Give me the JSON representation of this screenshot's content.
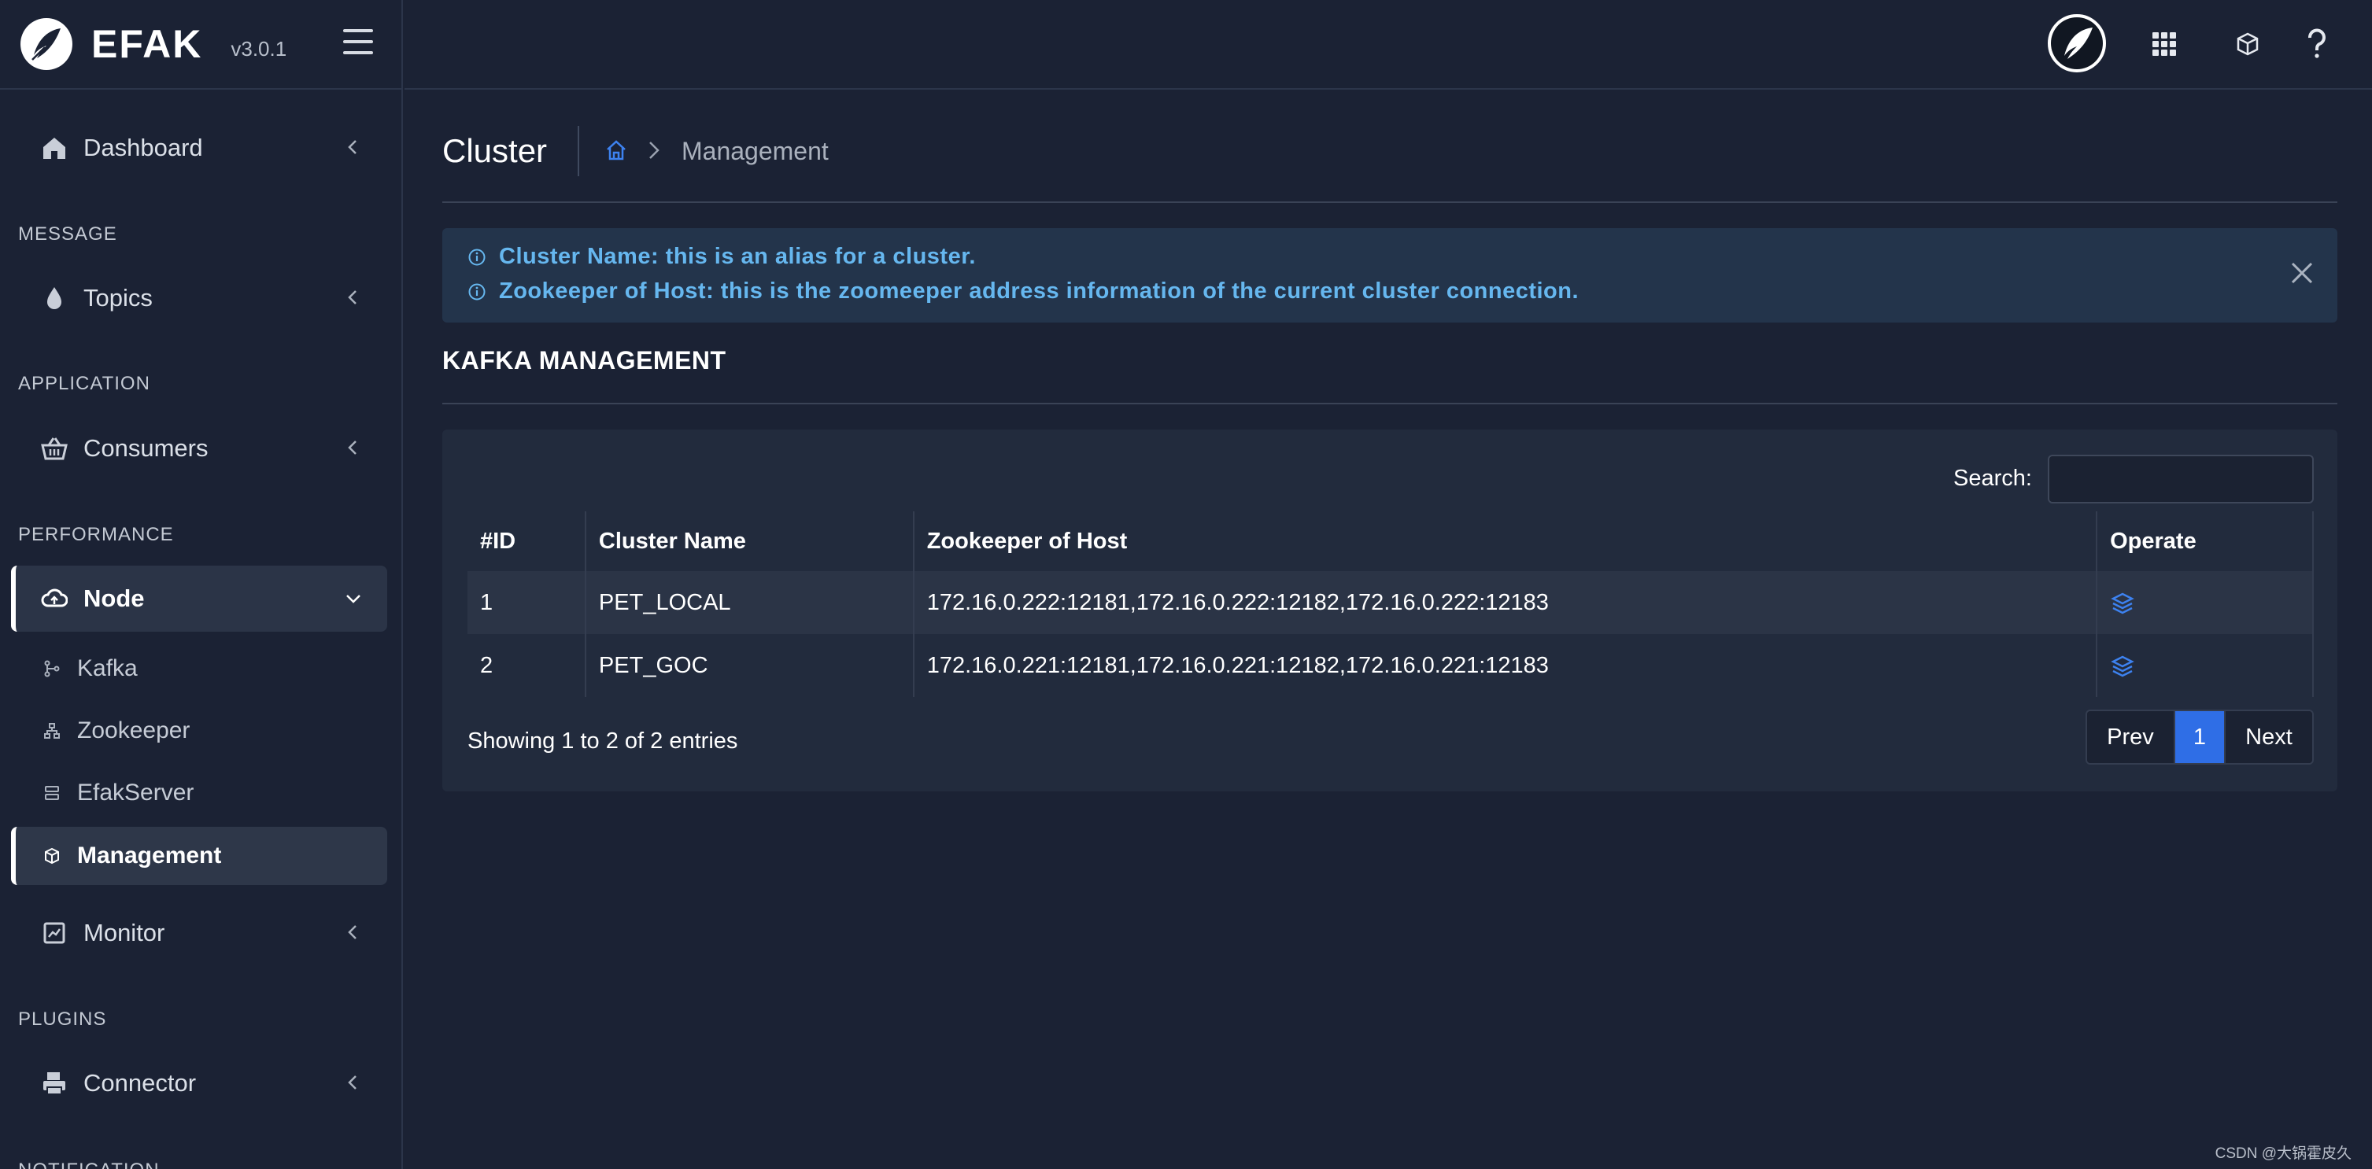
{
  "app": {
    "name": "EFAK",
    "version": "v3.0.1"
  },
  "sidebar": {
    "dashboard": "Dashboard",
    "sections": {
      "message": "MESSAGE",
      "application": "APPLICATION",
      "performance": "PERFORMANCE",
      "plugins": "PLUGINS",
      "notification": "NOTIFICATION"
    },
    "topics": "Topics",
    "consumers": "Consumers",
    "node": "Node",
    "node_children": [
      "Kafka",
      "Zookeeper",
      "EfakServer",
      "Management"
    ],
    "monitor": "Monitor",
    "connector": "Connector"
  },
  "page": {
    "title": "Cluster",
    "breadcrumb_current": "Management"
  },
  "alert": {
    "lines": [
      "Cluster Name: this is an alias for a cluster.",
      "Zookeeper of Host: this is the zoomeeper address information of the current cluster connection."
    ]
  },
  "section_title": "KAFKA MANAGEMENT",
  "table": {
    "search_label": "Search:",
    "search_value": "",
    "columns": [
      "#ID",
      "Cluster Name",
      "Zookeeper of Host",
      "Operate"
    ],
    "rows": [
      {
        "id": "1",
        "name": "PET_LOCAL",
        "host": "172.16.0.222:12181,172.16.0.222:12182,172.16.0.222:12183"
      },
      {
        "id": "2",
        "name": "PET_GOC",
        "host": "172.16.0.221:12181,172.16.0.221:12182,172.16.0.221:12183"
      }
    ],
    "info": "Showing 1 to 2 of 2 entries",
    "pager": {
      "prev": "Prev",
      "page": "1",
      "next": "Next"
    }
  },
  "watermark": "CSDN @大锅霍皮久",
  "colors": {
    "background": "#1b2234",
    "accent": "#2f6ee6",
    "alert_text": "#66b7ef",
    "alert_bg": "#23344b"
  },
  "icons": {
    "logo": "feather-logo-icon",
    "menu": "hamburger-icon",
    "apps": "grid-icon",
    "package": "cube-icon",
    "help": "question-icon",
    "home": "home-icon",
    "operate": "layers-icon"
  }
}
